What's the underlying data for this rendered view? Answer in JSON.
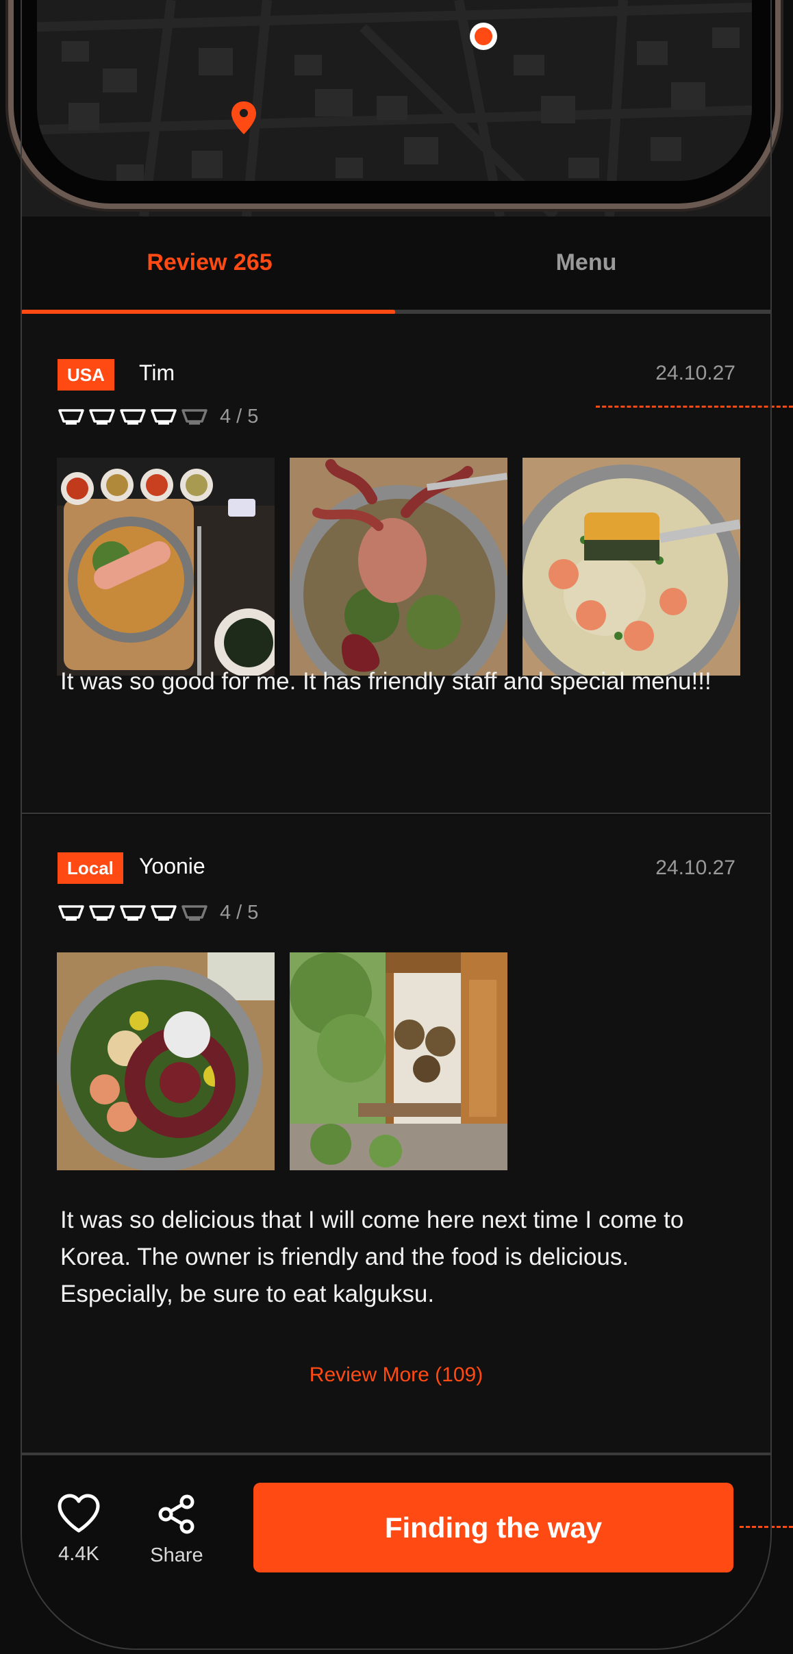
{
  "tabs": [
    {
      "label": "Review 265",
      "active": true
    },
    {
      "label": "Menu",
      "active": false
    }
  ],
  "reviews": [
    {
      "badge": "USA",
      "user": "Tim",
      "date": "24.10.27",
      "rating": 4,
      "rating_max": 5,
      "rating_text": "4 / 5",
      "photo_count": 3,
      "text": "It was so good for me. It has friendly staff and special menu!!!"
    },
    {
      "badge": "Local",
      "user": "Yoonie",
      "date": "24.10.27",
      "rating": 4,
      "rating_max": 5,
      "rating_text": "4 / 5",
      "photo_count": 2,
      "text": "It was so delicious that I will come here next time I come to Korea. The owner is friendly and the food is delicious. Especially, be sure to eat kalguksu."
    }
  ],
  "review_more_label": "Review More (109)",
  "bottom_bar": {
    "like_count": "4.4K",
    "share_label": "Share",
    "cta_label": "Finding the way"
  },
  "colors": {
    "accent": "#ff4a14",
    "background": "#0d0d0d",
    "card": "#111111",
    "muted_text": "#9a9a9a"
  },
  "icons": {
    "like": "heart-icon",
    "share": "share-icon",
    "rating": "bowl-icon",
    "map_pin": "map-pin-icon",
    "location": "current-location-icon"
  }
}
